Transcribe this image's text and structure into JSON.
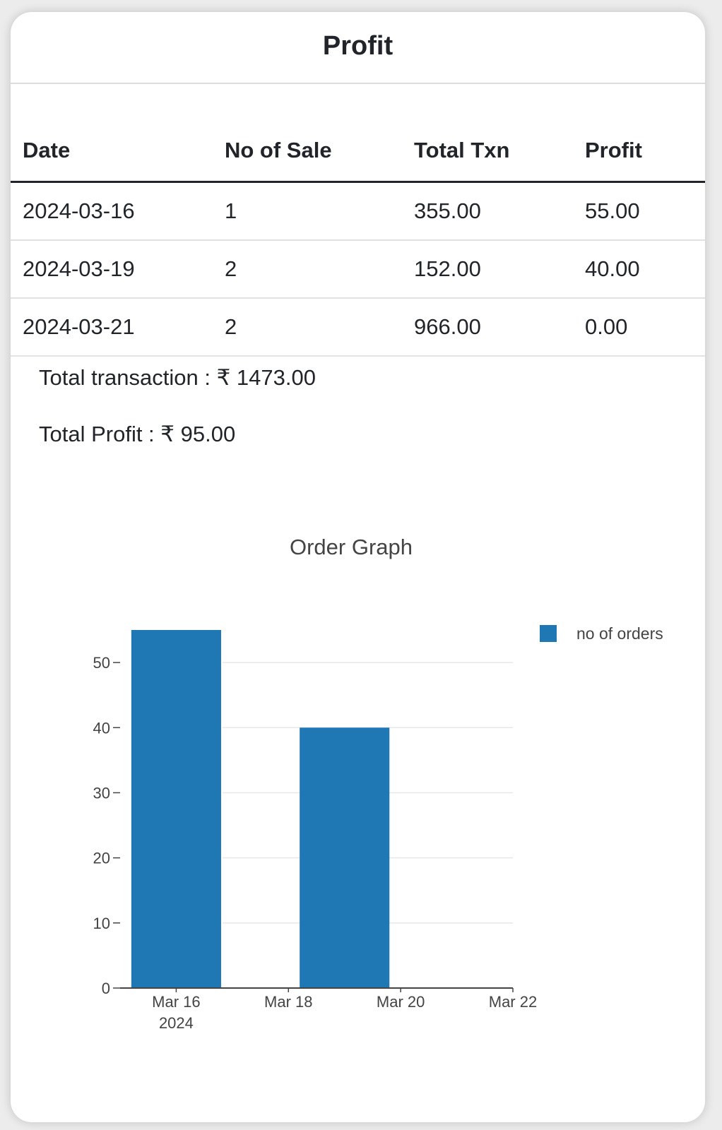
{
  "card": {
    "title": "Profit"
  },
  "table": {
    "headers": [
      "Date",
      "No of Sale",
      "Total Txn",
      "Profit"
    ],
    "rows": [
      [
        "2024-03-16",
        "1",
        "355.00",
        "55.00"
      ],
      [
        "2024-03-19",
        "2",
        "152.00",
        "40.00"
      ],
      [
        "2024-03-21",
        "2",
        "966.00",
        "0.00"
      ]
    ]
  },
  "summary": {
    "total_transaction": "Total transaction : ₹ 1473.00",
    "total_profit": "Total Profit : ₹ 95.00"
  },
  "colors": {
    "bar": "#1f77b4",
    "text": "#212529"
  },
  "chart_data": {
    "type": "bar",
    "title": "Order Graph",
    "xlabel": "",
    "ylabel": "",
    "x_axis": "date",
    "xlim": [
      "2024-03-15",
      "2024-03-22"
    ],
    "ylim": [
      0,
      55
    ],
    "yticks": [
      0,
      10,
      20,
      30,
      40,
      50
    ],
    "xticks": [
      {
        "date": "2024-03-16",
        "label": "Mar 16",
        "sublabel": "2024"
      },
      {
        "date": "2024-03-18",
        "label": "Mar 18",
        "sublabel": ""
      },
      {
        "date": "2024-03-20",
        "label": "Mar 20",
        "sublabel": ""
      },
      {
        "date": "2024-03-22",
        "label": "Mar 22",
        "sublabel": ""
      }
    ],
    "grid": true,
    "legend_position": "top-right",
    "series": [
      {
        "name": "no of orders",
        "color": "#1f77b4",
        "points": [
          {
            "date": "2024-03-16",
            "value": 55
          },
          {
            "date": "2024-03-19",
            "value": 40
          },
          {
            "date": "2024-03-21",
            "value": 0
          }
        ]
      }
    ]
  }
}
